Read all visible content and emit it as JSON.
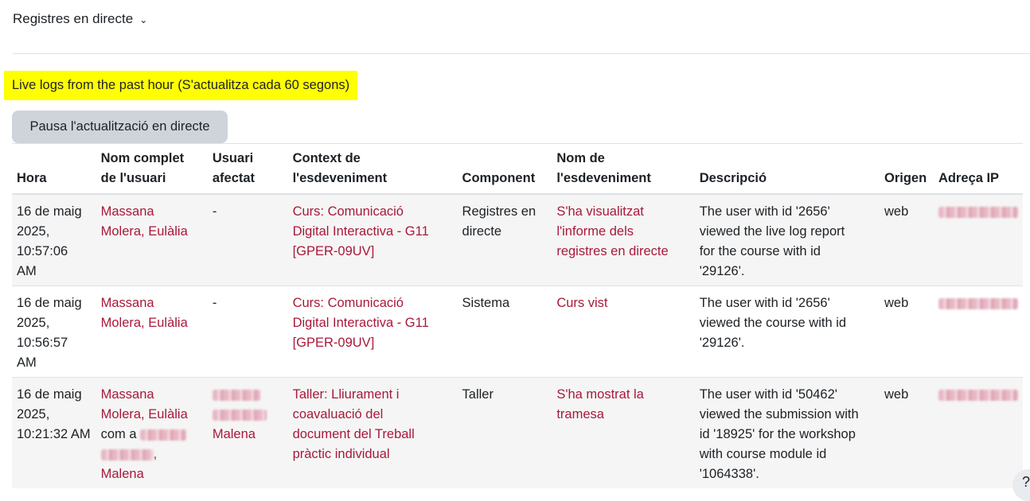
{
  "nav": {
    "title": "Registres en directe"
  },
  "banner": {
    "text": "Live logs from the past hour (S'actualitza cada 60 segons)"
  },
  "pause_button": "Pausa l'actualització en directe",
  "table": {
    "headers": {
      "time": "Hora",
      "fullname_line1": "Nom complet",
      "fullname_line2": "de l'usuari",
      "affected_line1": "Usuari",
      "affected_line2": "afectat",
      "context_line1": "Context de",
      "context_line2": "l'esdeveniment",
      "component": "Component",
      "event_line1": "Nom de",
      "event_line2": "l'esdeveniment",
      "description": "Descripció",
      "origin": "Origen",
      "ip": "Adreça IP"
    },
    "rows": [
      {
        "time_date": "16 de maig",
        "time_year": "2025,",
        "time_clock": "10:57:06",
        "time_ampm": "AM",
        "user_line1": "Massana",
        "user_line2": "Molera, Eulàlia",
        "affected": "-",
        "context_line1": "Curs: Comunicació",
        "context_line2": "Digital Interactiva - G11",
        "context_line3": "[GPER-09UV]",
        "component_line1": "Registres en",
        "component_line2": "directe",
        "event_line1": "S'ha visualitzat",
        "event_line2": "l'informe dels",
        "event_line3": "registres en directe",
        "desc_line1": "The user with id '2656'",
        "desc_line2": "viewed the live log report",
        "desc_line3": "for the course with id",
        "desc_line4": "'29126'.",
        "origin": "web"
      },
      {
        "time_date": "16 de maig",
        "time_year": "2025,",
        "time_clock": "10:56:57",
        "time_ampm": "AM",
        "user_line1": "Massana",
        "user_line2": "Molera, Eulàlia",
        "affected": "-",
        "context_line1": "Curs: Comunicació",
        "context_line2": "Digital Interactiva - G11",
        "context_line3": "[GPER-09UV]",
        "component_line1": "Sistema",
        "event_line1": "Curs vist",
        "desc_line1": "The user with id '2656'",
        "desc_line2": "viewed the course with id",
        "desc_line3": "'29126'.",
        "origin": "web"
      },
      {
        "time_date": "16 de maig",
        "time_year": "2025,",
        "time_clock": "10:21:32 AM",
        "user_line1": "Massana",
        "user_line2": "Molera, Eulàlia",
        "user_line3_prefix": "com a",
        "user_line4_suffix": ", Malena",
        "affected_last": "Malena",
        "context_line1": "Taller: Lliurament i",
        "context_line2": "coavaluació del",
        "context_line3": "document del Treball",
        "context_line4": "pràctic individual",
        "component_line1": "Taller",
        "event_line1": "S'ha mostrat la",
        "event_line2": "tramesa",
        "desc_line1": "The user with id '50462'",
        "desc_line2": "viewed the submission with",
        "desc_line3": "id '18925' for the workshop",
        "desc_line4": "with course module id",
        "desc_line5": "'1064338'.",
        "origin": "web"
      }
    ]
  },
  "help": {
    "label": "?"
  }
}
